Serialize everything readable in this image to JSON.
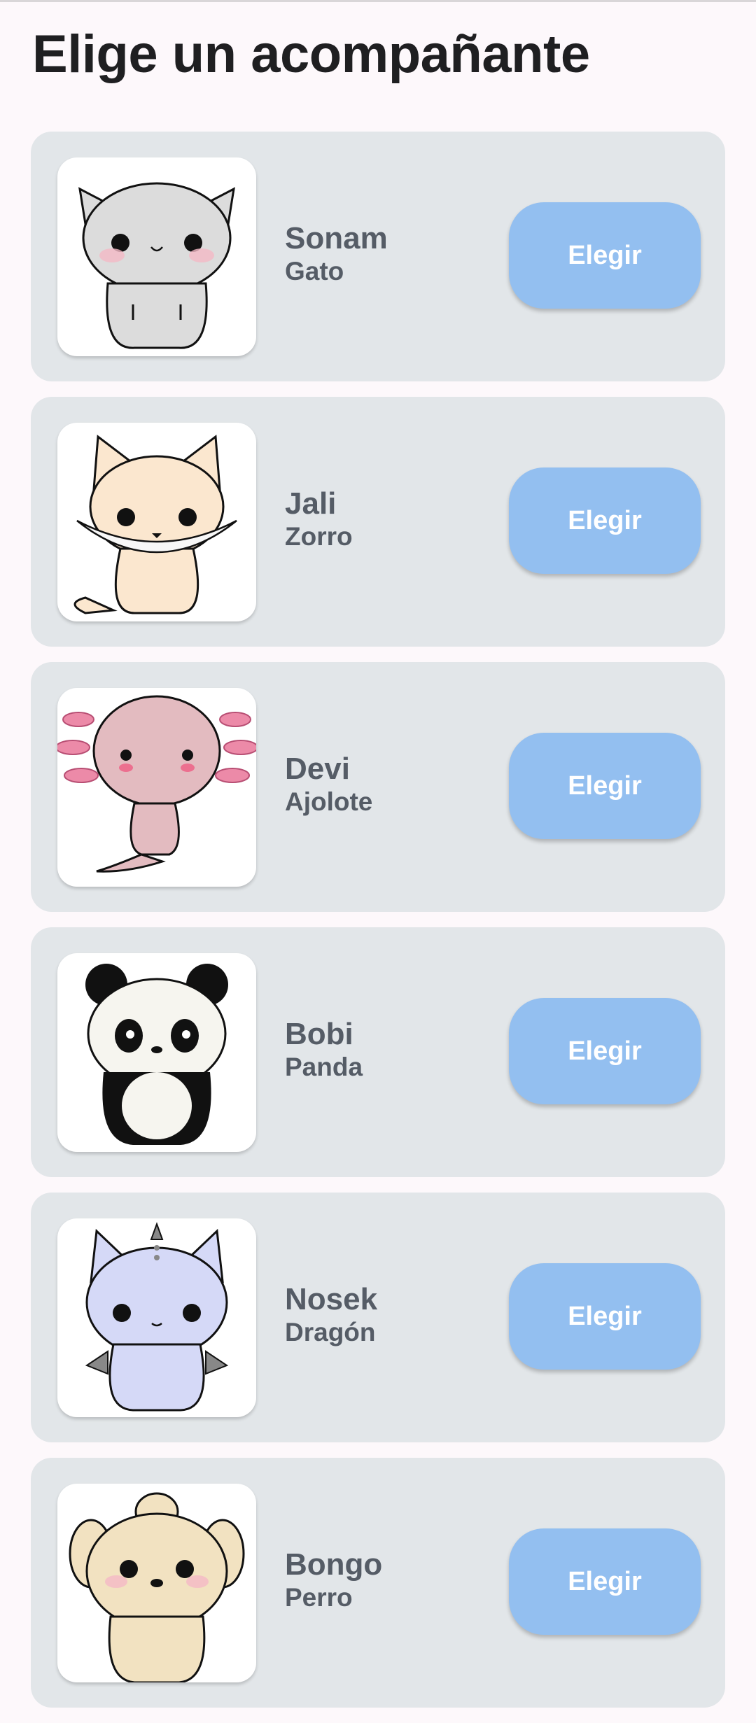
{
  "page": {
    "title": "Elige un acompañante"
  },
  "companions": [
    {
      "name": "Sonam",
      "species": "Gato",
      "button": "Elegir",
      "icon": "cat-icon"
    },
    {
      "name": "Jali",
      "species": "Zorro",
      "button": "Elegir",
      "icon": "fox-icon"
    },
    {
      "name": "Devi",
      "species": "Ajolote",
      "button": "Elegir",
      "icon": "axolotl-icon"
    },
    {
      "name": "Bobi",
      "species": "Panda",
      "button": "Elegir",
      "icon": "panda-icon"
    },
    {
      "name": "Nosek",
      "species": "Dragón",
      "button": "Elegir",
      "icon": "dragon-icon"
    },
    {
      "name": "Bongo",
      "species": "Perro",
      "button": "Elegir",
      "icon": "dog-icon"
    }
  ],
  "colors": {
    "background": "#fdf8fb",
    "card": "#e2e6e9",
    "button": "#93bff0",
    "button_text": "#ffffff",
    "label_text": "#555c66",
    "title_text": "#1f1f21"
  }
}
